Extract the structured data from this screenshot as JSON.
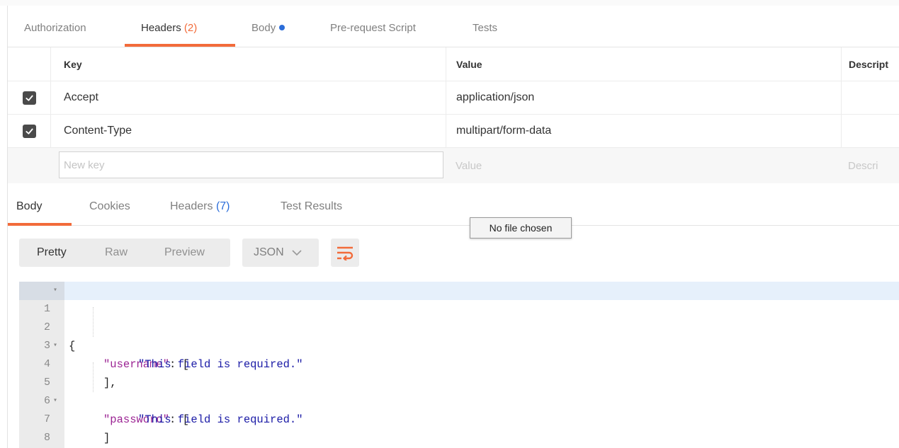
{
  "request_tabs": [
    {
      "label": "Authorization"
    },
    {
      "label": "Headers",
      "count": "(2)"
    },
    {
      "label": "Body"
    },
    {
      "label": "Pre-request Script"
    },
    {
      "label": "Tests"
    }
  ],
  "headers_table": {
    "columns": {
      "key": "Key",
      "value": "Value",
      "description": "Descript"
    },
    "rows": [
      {
        "checked": true,
        "key": "Accept",
        "value": "application/json"
      },
      {
        "checked": true,
        "key": "Content-Type",
        "value": "multipart/form-data"
      }
    ],
    "new_row": {
      "key_placeholder": "New key",
      "value_placeholder": "Value",
      "description_placeholder": "Descri"
    }
  },
  "response_tabs": [
    {
      "label": "Body"
    },
    {
      "label": "Cookies"
    },
    {
      "label": "Headers",
      "count": "(7)"
    },
    {
      "label": "Test Results"
    }
  ],
  "tooltip": "No file chosen",
  "view_modes": [
    "Pretty",
    "Raw",
    "Preview"
  ],
  "format_select": {
    "value": "JSON"
  },
  "code_lines": [
    {
      "n": "1",
      "fold": true
    },
    {
      "n": "2",
      "fold": true,
      "key": "\"username\"",
      "rest": ": ["
    },
    {
      "n": "3",
      "str": "\"This field is required.\""
    },
    {
      "n": "4",
      "text": "],"
    },
    {
      "n": "5",
      "fold": true,
      "key": "\"password\"",
      "rest": ": ["
    },
    {
      "n": "6",
      "str": "\"This field is required.\""
    },
    {
      "n": "7",
      "text": "]"
    },
    {
      "n": "8",
      "text": "}"
    }
  ],
  "code_open_brace": "{",
  "icons": [
    "checkbox-checked-icon",
    "chevron-down-icon",
    "wrap-lines-icon",
    "fold-arrow-icon"
  ],
  "colors": {
    "accent": "#f26b3a",
    "count_blue": "#2b6dd9",
    "json_key": "#9b2393",
    "json_string": "#1a1aa6"
  }
}
